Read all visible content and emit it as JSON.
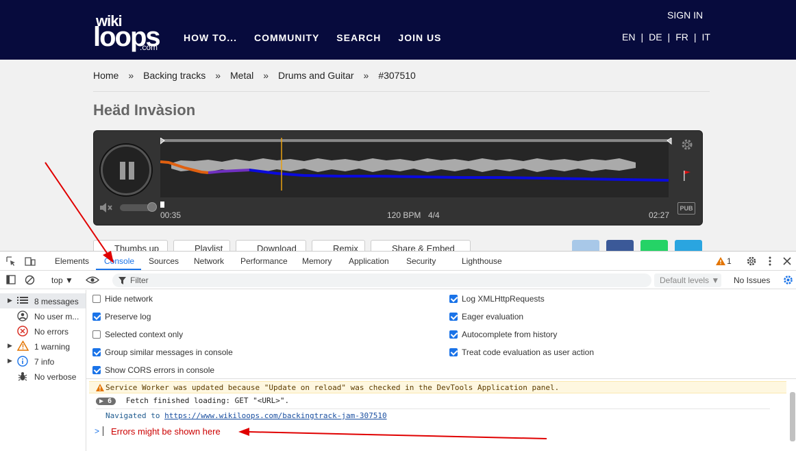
{
  "site": {
    "logo": {
      "top": "wiki",
      "main": "loops",
      "suffix": ".com"
    },
    "nav": [
      "HOW TO...",
      "COMMUNITY",
      "SEARCH",
      "JOIN US"
    ],
    "sign_in": "SIGN IN",
    "languages": [
      "EN",
      "DE",
      "FR",
      "IT"
    ],
    "lang_sep": "|"
  },
  "breadcrumb": {
    "items": [
      "Home",
      "Backing tracks",
      "Metal",
      "Drums and Guitar",
      "#307510"
    ],
    "sep": "»"
  },
  "track": {
    "title": "Heäd Invàsion",
    "time_current": "00:35",
    "bpm": "120 BPM",
    "meter": "4/4",
    "time_total": "02:27",
    "pub_badge": "PUB",
    "progress_fraction": 0.238
  },
  "actions": [
    "Thumbs up",
    "Playlist",
    "Download",
    "Remix",
    "Share & Embed"
  ],
  "devtools": {
    "tabs": [
      "Elements",
      "Console",
      "Sources",
      "Network",
      "Performance",
      "Memory",
      "Application",
      "Security",
      "Lighthouse"
    ],
    "active_tab": "Console",
    "warning_count": "1",
    "context": "top ▼",
    "filter_placeholder": "Filter",
    "levels": "Default levels ▼",
    "no_issues": "No Issues",
    "sidebar": [
      {
        "label": "8 messages",
        "icon": "list-icon",
        "caret": true
      },
      {
        "label": "No user m...",
        "icon": "user-icon",
        "caret": false
      },
      {
        "label": "No errors",
        "icon": "error-icon",
        "caret": false
      },
      {
        "label": "1 warning",
        "icon": "warning-icon",
        "caret": true
      },
      {
        "label": "7 info",
        "icon": "info-icon",
        "caret": true
      },
      {
        "label": "No verbose",
        "icon": "bug-icon",
        "caret": false
      }
    ],
    "settings_left": [
      {
        "label": "Hide network",
        "checked": false
      },
      {
        "label": "Preserve log",
        "checked": true
      },
      {
        "label": "Selected context only",
        "checked": false
      },
      {
        "label": "Group similar messages in console",
        "checked": true
      },
      {
        "label": "Show CORS errors in console",
        "checked": true
      }
    ],
    "settings_right": [
      {
        "label": "Log XMLHttpRequests",
        "checked": true
      },
      {
        "label": "Eager evaluation",
        "checked": true
      },
      {
        "label": "Autocomplete from history",
        "checked": true
      },
      {
        "label": "Treat code evaluation as user action",
        "checked": true
      }
    ],
    "messages": {
      "warning": "Service Worker was updated because \"Update on reload\" was checked in the DevTools Application panel.",
      "fetch_count": "6",
      "fetch": "Fetch finished loading: GET \"<URL>\".",
      "navigated_prefix": "Navigated to ",
      "navigated_url": "https://www.wikiloops.com/backingtrack-jam-307510"
    },
    "prompt_symbol": ">",
    "annotation": "Errors might be shown here"
  },
  "colors": {
    "header_bg": "#070b3d",
    "devtools_accent": "#1a73e8",
    "annotation_red": "#e00000"
  }
}
